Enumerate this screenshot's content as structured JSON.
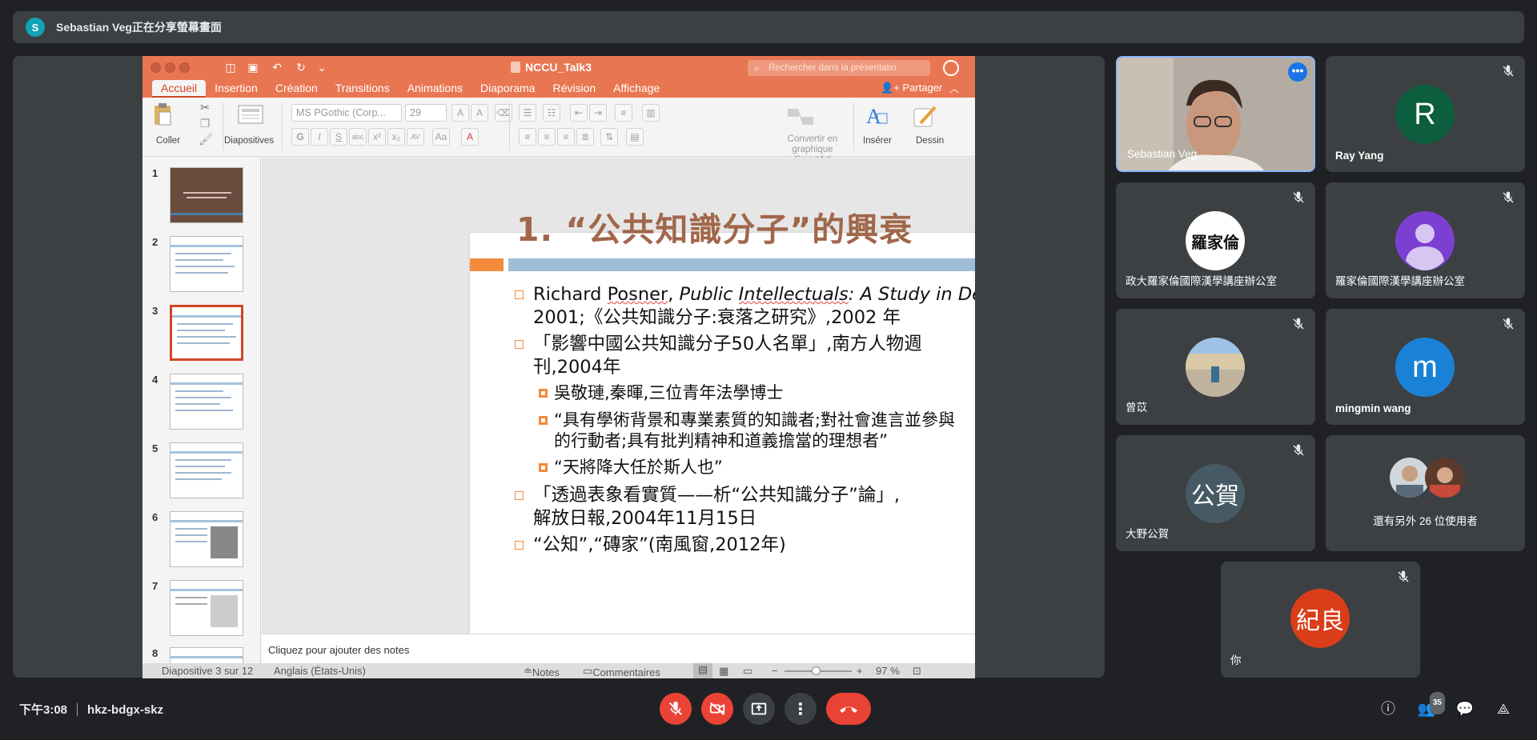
{
  "share_bar": {
    "avatar_letter": "S",
    "text": "Sebastian Veg正在分享螢幕畫面"
  },
  "ppt": {
    "doc_title": "NCCU_Talk3",
    "search_placeholder": "Rechercher dans la présentatio",
    "tabs": [
      "Accueil",
      "Insertion",
      "Création",
      "Transitions",
      "Animations",
      "Diaporama",
      "Révision",
      "Affichage"
    ],
    "active_tab": "Accueil",
    "partager": "Partager",
    "ribbon": {
      "coller": "Coller",
      "diapositives": "Diapositives",
      "font_name": "MS PGothic (Corp...",
      "font_size": "29",
      "smartart": "Convertir en graphique SmartArt",
      "inserer": "Insérer",
      "dessin": "Dessin"
    },
    "thumb_numbers": [
      "1",
      "2",
      "3",
      "4",
      "5",
      "6",
      "7",
      "8"
    ],
    "selected_slide": 3,
    "slide": {
      "title": "1. “公共知識分子”的興衰",
      "bullets": [
        {
          "level": 1,
          "parts": [
            "Richard ",
            "Posner",
            ", ",
            "Public ",
            "Intellectuals",
            ": A Study in Decline",
            ","
          ],
          "line2": "2001;《公共知識分子:衰落之研究》,2002 年"
        },
        {
          "level": 1,
          "text": "「影響中國公共知識分子50人名單」,南方人物週",
          "line2": "刊,2004年"
        },
        {
          "level": 2,
          "text": "吳敬璉,秦暉,三位青年法學博士"
        },
        {
          "level": 2,
          "text": "“具有學術背景和專業素質的知識者;對社會進言並參與",
          "line2": "的行動者;具有批判精神和道義擔當的理想者”"
        },
        {
          "level": 2,
          "text": "“天將降大任於斯人也”"
        },
        {
          "level": 1,
          "text": "「透過表象看實質——析“公共知識分子”論」,",
          "line2": "解放日報,2004年11月15日"
        },
        {
          "level": 1,
          "text": "“公知”,“磚家”(南風窗,2012年)"
        }
      ]
    },
    "notes_placeholder": "Cliquez pour ajouter des notes",
    "status": {
      "slide_counter": "Diapositive 3 sur 12",
      "language": "Anglais (États-Unis)",
      "notes": "Notes",
      "comments": "Commentaires",
      "zoom": "97 %"
    }
  },
  "participants": [
    {
      "name": "Sebastian Veg",
      "type": "video"
    },
    {
      "name": "Ray Yang",
      "type": "initial",
      "initial": "R",
      "color": "#0d5e3f"
    },
    {
      "name": "政大羅家倫國際漢學講座辦公室",
      "type": "logo",
      "logo_text": "羅家倫"
    },
    {
      "name": "羅家倫國際漢學講座辦公室",
      "type": "default-avatar",
      "color": "#7b3fd1"
    },
    {
      "name": "曾苡",
      "type": "photo"
    },
    {
      "name": "mingmin wang",
      "type": "initial",
      "initial": "m",
      "color": "#1a82d6"
    },
    {
      "name": "大野公賀",
      "type": "initial",
      "initial": "公賀",
      "color": "#455a64"
    },
    {
      "name": "還有另外 26 位使用者",
      "type": "others"
    },
    {
      "name": "你",
      "type": "initial",
      "initial": "紀良",
      "color": "#d93d19"
    }
  ],
  "bottom": {
    "time": "下午3:08",
    "meeting_code": "hkz-bdgx-skz",
    "people_count": "35"
  }
}
